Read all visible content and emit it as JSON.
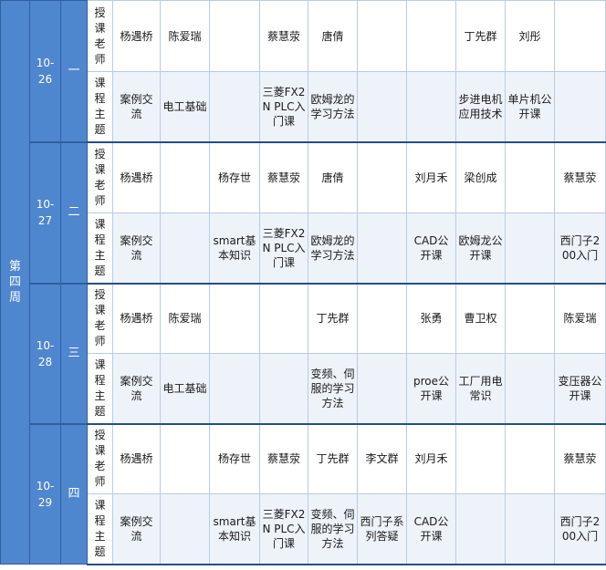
{
  "week": "第四周",
  "row_labels": {
    "teacher": "授课老师",
    "topic": "课程主题"
  },
  "days": [
    {
      "date": "10-26",
      "weekday": "一",
      "teachers": [
        "杨遇桥",
        "陈爱瑞",
        "",
        "蔡慧荥",
        "唐倩",
        "",
        "",
        "丁先群",
        "刘彤",
        ""
      ],
      "topics": [
        "案例交流",
        "电工基础",
        "",
        "三菱FX2N PLC入门课",
        "欧姆龙的学习方法",
        "",
        "",
        "步进电机应用技术",
        "单片机公开课",
        ""
      ]
    },
    {
      "date": "10-27",
      "weekday": "二",
      "teachers": [
        "杨遇桥",
        "",
        "杨存世",
        "蔡慧荥",
        "唐倩",
        "",
        "刘月禾",
        "梁创成",
        "",
        "蔡慧荥"
      ],
      "topics": [
        "案例交流",
        "",
        "smart基本知识",
        "三菱FX2N PLC入门课",
        "欧姆龙的学习方法",
        "",
        "CAD公开课",
        "欧姆龙公开课",
        "",
        "西门子200入门"
      ]
    },
    {
      "date": "10-28",
      "weekday": "三",
      "teachers": [
        "杨遇桥",
        "陈爱瑞",
        "",
        "",
        "丁先群",
        "",
        "张勇",
        "曹卫权",
        "",
        "陈爱瑞"
      ],
      "topics": [
        "案例交流",
        "电工基础",
        "",
        "",
        "变频、伺服的学习方法",
        "",
        "proe公开课",
        "工厂用电常识",
        "",
        "变压器公开课"
      ]
    },
    {
      "date": "10-29",
      "weekday": "四",
      "teachers": [
        "杨遇桥",
        "",
        "杨存世",
        "蔡慧荥",
        "丁先群",
        "李文群",
        "刘月禾",
        "",
        "",
        "蔡慧荥"
      ],
      "topics": [
        "案例交流",
        "",
        "smart基本知识",
        "三菱FX2N PLC入门课",
        "变频、伺服的学习方法",
        "西门子系列答疑",
        "CAD公开课",
        "",
        "",
        "西门子200入门"
      ]
    }
  ]
}
